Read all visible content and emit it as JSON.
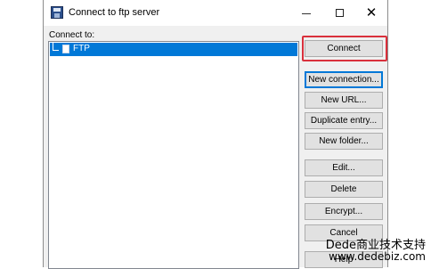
{
  "window": {
    "title": "Connect to ftp server",
    "controls": {
      "minimize": "minimize",
      "maximize": "maximize",
      "close": "✕"
    }
  },
  "tree": {
    "label": "Connect to:",
    "items": [
      {
        "label": "FTP",
        "selected": true,
        "icon": "server-icon"
      }
    ]
  },
  "buttons": {
    "connect": "Connect",
    "new_connection": "New connection...",
    "new_url": "New URL...",
    "duplicate": "Duplicate entry...",
    "new_folder": "New folder...",
    "edit": "Edit...",
    "delete": "Delete",
    "encrypt": "Encrypt...",
    "cancel": "Cancel",
    "help": "Help"
  },
  "watermark": {
    "line1": "Dede商业技术支持",
    "line2": "www.dedebiz.com"
  },
  "colors": {
    "selection": "#0078d7",
    "highlight_box": "#d9303c",
    "button_face": "#e1e1e1"
  }
}
